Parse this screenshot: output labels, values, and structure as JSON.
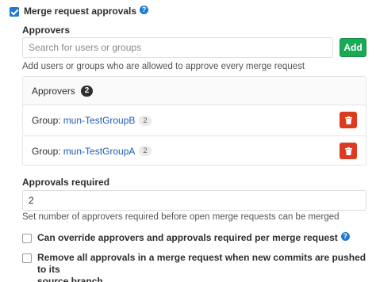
{
  "approvals_toggle": {
    "label": "Merge request approvals",
    "checked": true,
    "help_icon": "question-circle-icon"
  },
  "approvers_section": {
    "label": "Approvers",
    "search_placeholder": "Search for users or groups",
    "add_label": "Add",
    "hint": "Add users or groups who are allowed to approve every merge request"
  },
  "approvers_panel": {
    "title": "Approvers",
    "count": "2",
    "rows": [
      {
        "prefix": "Group:",
        "name": "mun-TestGroupB",
        "members": "2",
        "action_icon": "trash-icon"
      },
      {
        "prefix": "Group:",
        "name": "mun-TestGroupA",
        "members": "2",
        "action_icon": "trash-icon"
      }
    ]
  },
  "approvals_required": {
    "label": "Approvals required",
    "value": "2",
    "hint": "Set number of approvers required before open merge requests can be merged"
  },
  "override_option": {
    "label": "Can override approvers and approvals required per merge request",
    "checked": false,
    "help_icon": "question-circle-icon"
  },
  "reset_option": {
    "label_line1": "Remove all approvals in a merge request when new commits are pushed to its",
    "label_line2": "source branch",
    "checked": false
  },
  "colors": {
    "accent": "#1f78d1",
    "add_button": "#1aaa55",
    "danger": "#db3b21",
    "link": "#1f5db3"
  }
}
